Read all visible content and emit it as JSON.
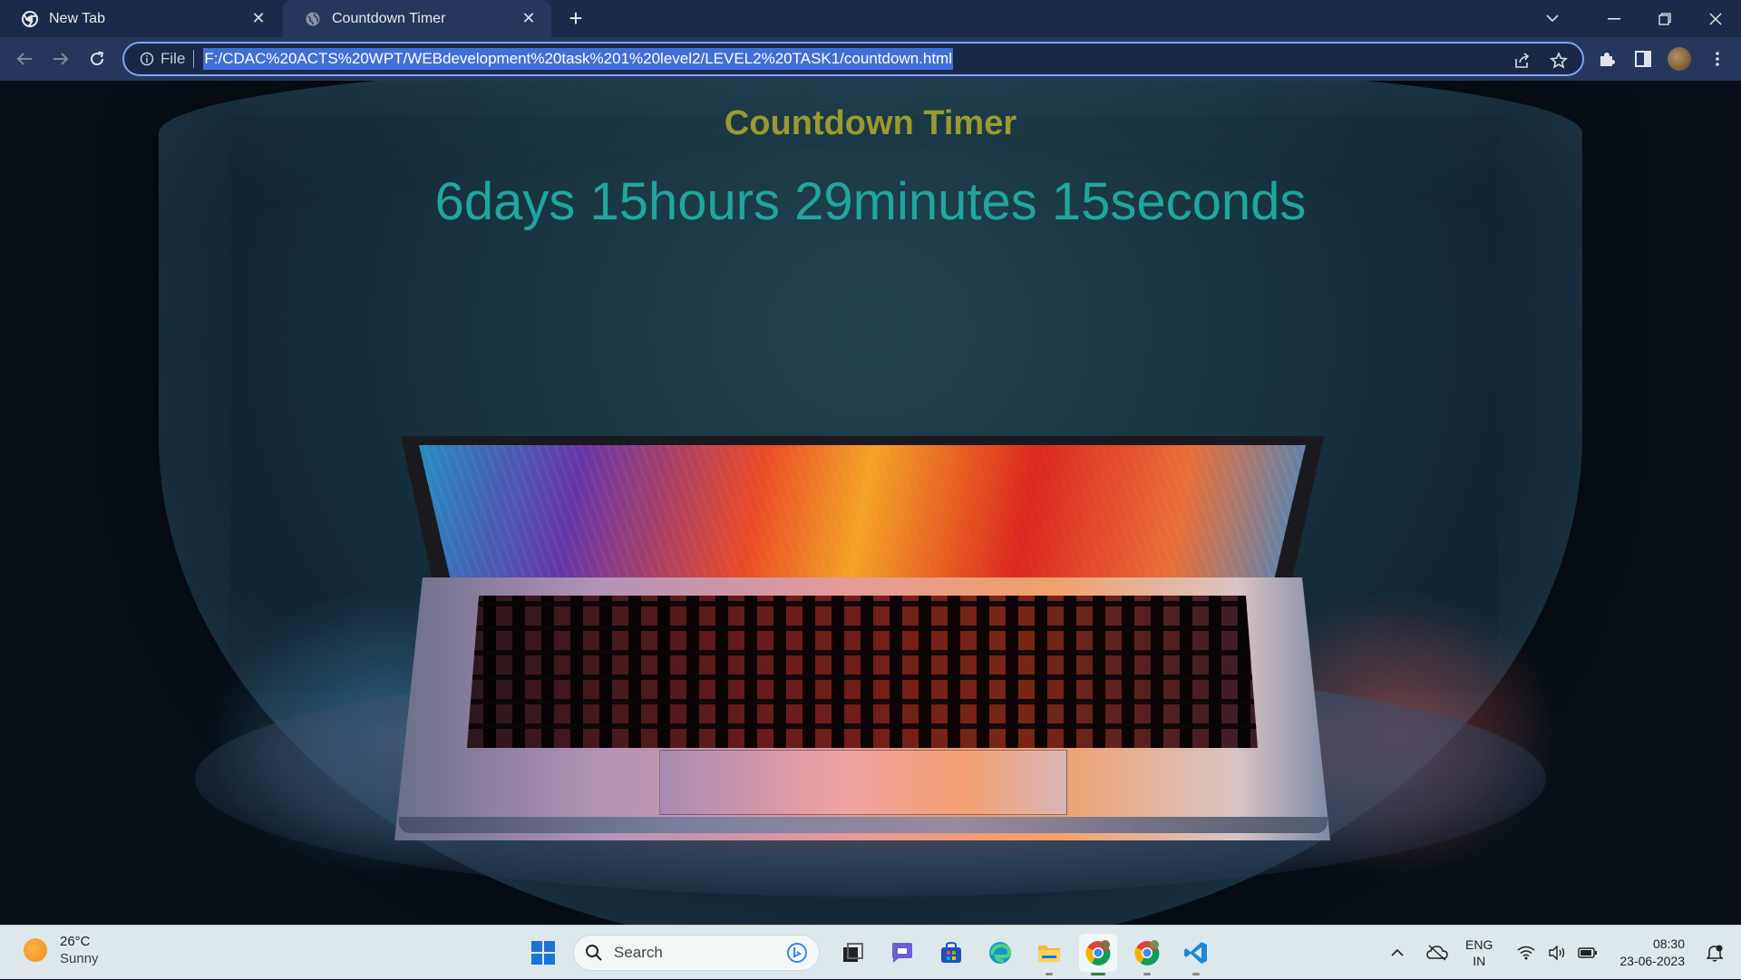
{
  "browser": {
    "tabs": [
      {
        "title": "New Tab",
        "active": false
      },
      {
        "title": "Countdown Timer",
        "active": true
      }
    ],
    "new_tab_symbol": "+",
    "omnibox": {
      "scheme_label": "File",
      "url": "F:/CDAC%20ACTS%20WPT/WEBdevelopment%20task%201%20level2/LEVEL2%20TASK1/countdown.html"
    },
    "icons": {
      "back": "arrow-left-icon",
      "forward": "arrow-right-icon",
      "reload": "reload-icon",
      "info": "info-icon",
      "share": "share-icon",
      "bookmark": "star-icon",
      "extensions": "puzzle-icon",
      "side_panel": "side-panel-icon",
      "menu": "kebab-menu-icon"
    }
  },
  "page": {
    "heading": "Countdown Timer",
    "countdown": "6days 15hours 29minutes 15seconds",
    "colors": {
      "heading": "#9a9a30",
      "countdown": "#1fa6a0"
    }
  },
  "taskbar": {
    "weather": {
      "temperature": "26°C",
      "condition": "Sunny"
    },
    "search_label": "Search",
    "apps": [
      "task-view",
      "teams-chat",
      "microsoft-store",
      "edge",
      "file-explorer",
      "chrome",
      "chrome-profile",
      "vs-code"
    ],
    "language": {
      "line1": "ENG",
      "line2": "IN"
    },
    "clock": {
      "time": "08:30",
      "date": "23-06-2023"
    }
  }
}
